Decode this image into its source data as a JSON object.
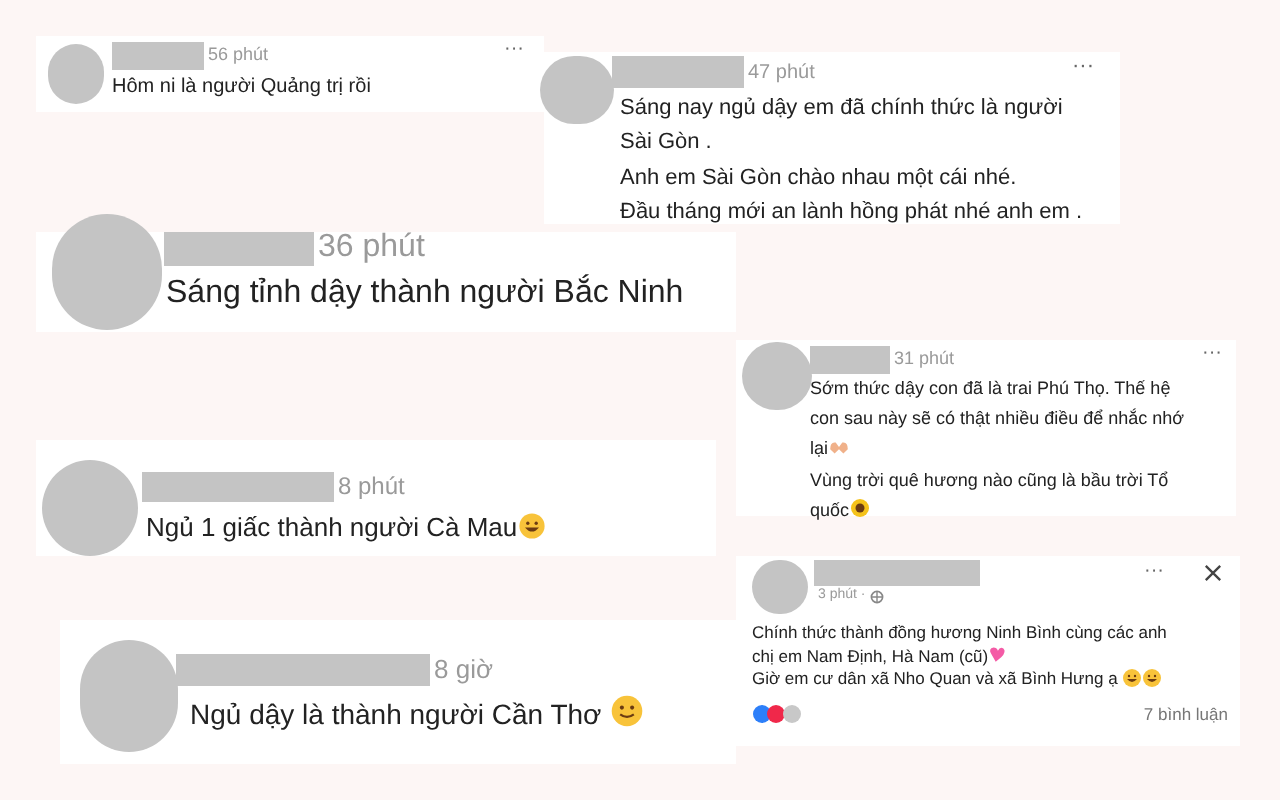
{
  "posts": [
    {
      "time": "56 phút",
      "menu": "···",
      "lines": [
        "Hôm ni là người Quảng trị rồi"
      ]
    },
    {
      "time": "47 phút",
      "menu": "···",
      "lines": [
        "Sáng nay ngủ dậy em đã chính thức là người",
        "Sài Gòn .",
        "Anh em Sài Gòn chào nhau một cái nhé.",
        "Đầu tháng mới an lành hồng phát nhé anh em ."
      ]
    },
    {
      "time": "36 phút",
      "lines": [
        "Sáng tỉnh dậy thành người Bắc Ninh"
      ]
    },
    {
      "time": "31 phút",
      "menu": "···",
      "lines": [
        "Sớm thức dậy con đã là trai Phú Thọ. Thế hệ",
        "con sau này sẽ có thật nhiều điều để nhắc nhớ",
        "lại",
        "Vùng trời quê hương nào cũng là bầu trời Tổ",
        "quốc"
      ]
    },
    {
      "time": "8 phút",
      "lines": [
        "Ngủ 1 giấc thành người Cà Mau"
      ]
    },
    {
      "time": "8 giờ",
      "lines": [
        "Ngủ dậy là thành người Cần Thơ"
      ]
    },
    {
      "time": "3 phút ·",
      "menu": "···",
      "lines": [
        "Chính thức thành đồng hương Ninh Bình cùng các anh",
        "chị em Nam Định, Hà Nam (cũ)",
        "Giờ em cư dân xã Nho Quan và xã Bình Hưng ạ"
      ],
      "comments": "7 bình luận"
    }
  ]
}
